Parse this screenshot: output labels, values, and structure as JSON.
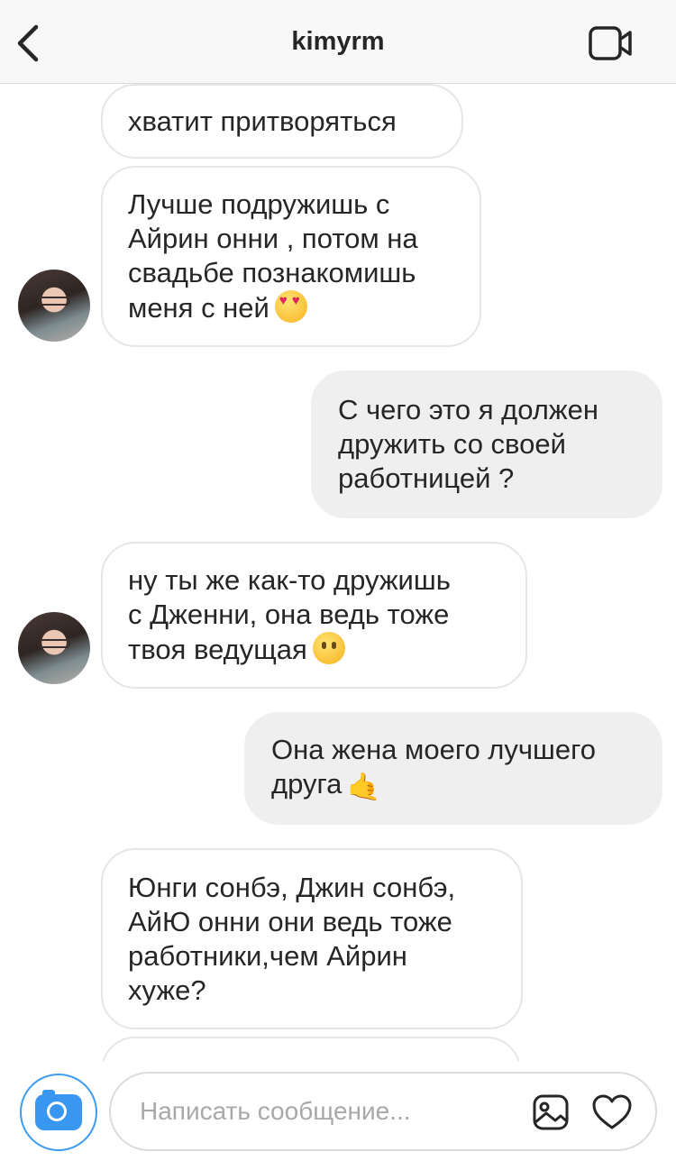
{
  "header": {
    "title": "kimyrm",
    "back_icon": "chevron-left-icon",
    "video_icon": "video-call-icon"
  },
  "messages": [
    {
      "side": "in",
      "text": "хватит притворяться"
    },
    {
      "side": "in",
      "text": "Лучше подружишь с\nАйрин онни , потом на\nсвадьбе познакомишь\nменя с ней",
      "emoji": "heart-eyes"
    },
    {
      "side": "out",
      "text": "С чего это я должен\nдружить со своей\nработницей ?"
    },
    {
      "side": "in",
      "text": "ну ты же как-то дружишь\nс Дженни, она ведь тоже\nтвоя ведущая",
      "emoji": "confused"
    },
    {
      "side": "out",
      "text": "Она жена моего лучшего\nдруга",
      "emoji": "call-me-hand"
    },
    {
      "side": "in",
      "text": "Юнги сонбэ, Джин сонбэ,\nАйЮ онни они ведь тоже\nработники,чем Айрин\nхуже?"
    }
  ],
  "composer": {
    "placeholder": "Написать сообщение...",
    "camera_icon": "camera-icon",
    "gallery_icon": "gallery-icon",
    "like_icon": "heart-icon"
  },
  "colors": {
    "accent": "#3897f0",
    "bubble_out": "#efefef",
    "bubble_in_border": "#e6e6e6"
  }
}
